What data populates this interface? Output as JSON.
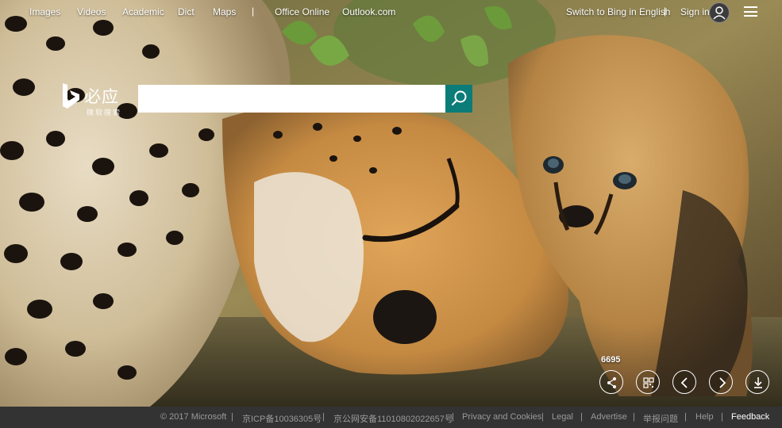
{
  "nav": {
    "links": [
      "Images",
      "Videos",
      "Academic",
      "Dict",
      "Maps"
    ],
    "separator": "|",
    "links2": [
      "Office Online",
      "Outlook.com"
    ],
    "switch_lang": "Switch to Bing in English",
    "sign_in": "Sign in"
  },
  "logo": {
    "title": "必应",
    "subtitle": "微软搜索",
    "icon": "bing-logo-icon"
  },
  "search": {
    "value": "",
    "placeholder": "",
    "button_icon": "search-icon"
  },
  "hero": {
    "counter": "6695",
    "controls": [
      "share-icon",
      "qr-code-icon",
      "chevron-left-icon",
      "chevron-right-icon",
      "download-icon"
    ]
  },
  "footer": {
    "items": [
      "© 2017 Microsoft",
      "京ICP备10036305号",
      "京公网安备11010802022657号",
      "Privacy and Cookies",
      "Legal",
      "Advertise",
      "举报问题",
      "Help",
      "Feedback"
    ],
    "separator": "|"
  },
  "colors": {
    "accent": "#0b7c78",
    "footer_bg": "#333333"
  }
}
